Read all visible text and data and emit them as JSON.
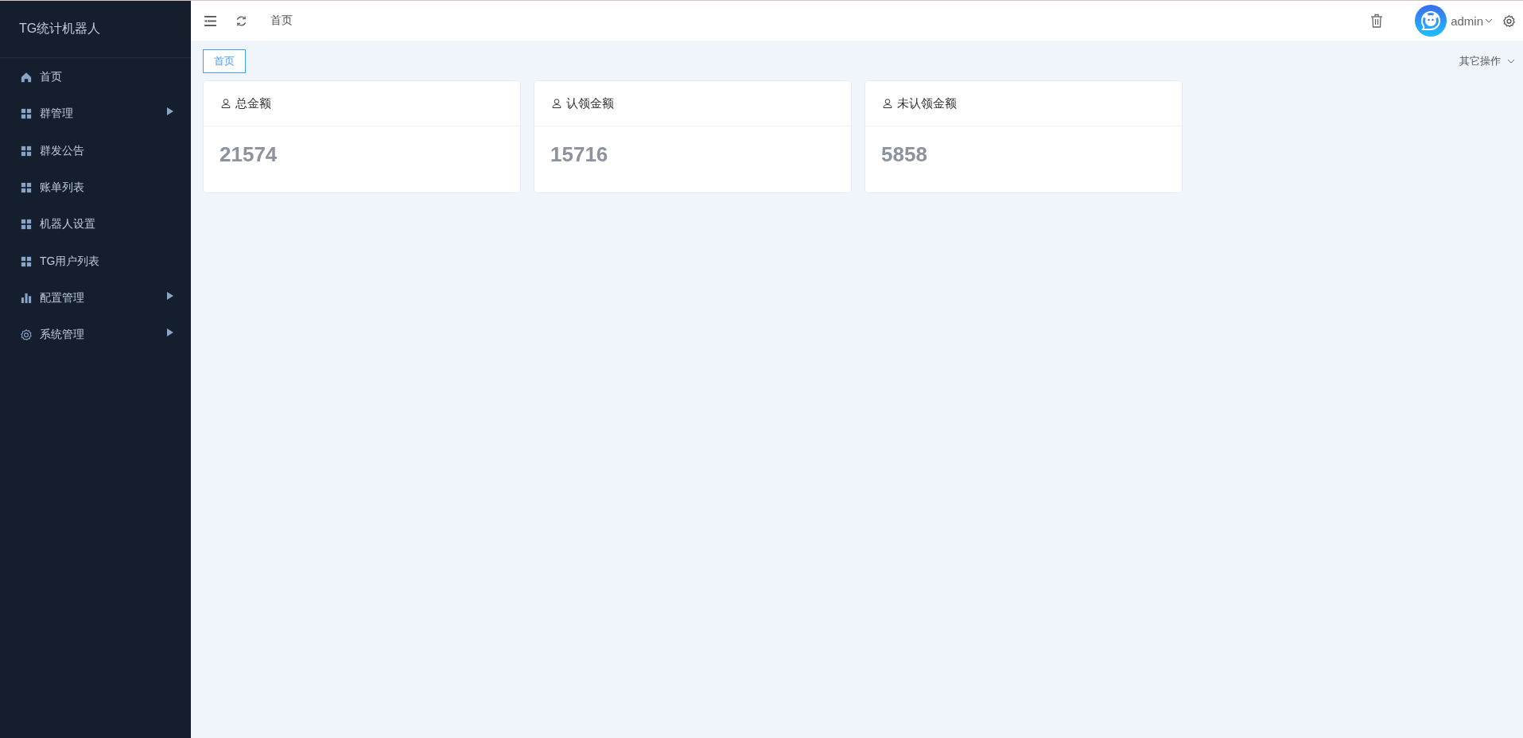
{
  "sidebar": {
    "title": "TG统计机器人",
    "items": [
      {
        "label": "首页",
        "kind": "home",
        "has_submenu": false
      },
      {
        "label": "群管理",
        "kind": "grid",
        "has_submenu": true
      },
      {
        "label": "群发公告",
        "kind": "grid",
        "has_submenu": false
      },
      {
        "label": "账单列表",
        "kind": "grid",
        "has_submenu": false
      },
      {
        "label": "机器人设置",
        "kind": "grid",
        "has_submenu": false
      },
      {
        "label": "TG用户列表",
        "kind": "grid",
        "has_submenu": false
      },
      {
        "label": "配置管理",
        "kind": "chart",
        "has_submenu": true
      },
      {
        "label": "系统管理",
        "kind": "gear",
        "has_submenu": true
      }
    ]
  },
  "header": {
    "breadcrumb": "首页",
    "user": "admin"
  },
  "tabs": [
    {
      "label": "首页",
      "selected": true
    }
  ],
  "tab_actions": "其它操作",
  "cards": [
    {
      "title": "总金额",
      "value": "21574"
    },
    {
      "title": "认领金额",
      "value": "15716"
    },
    {
      "title": "未认领金额",
      "value": "5858"
    }
  ]
}
